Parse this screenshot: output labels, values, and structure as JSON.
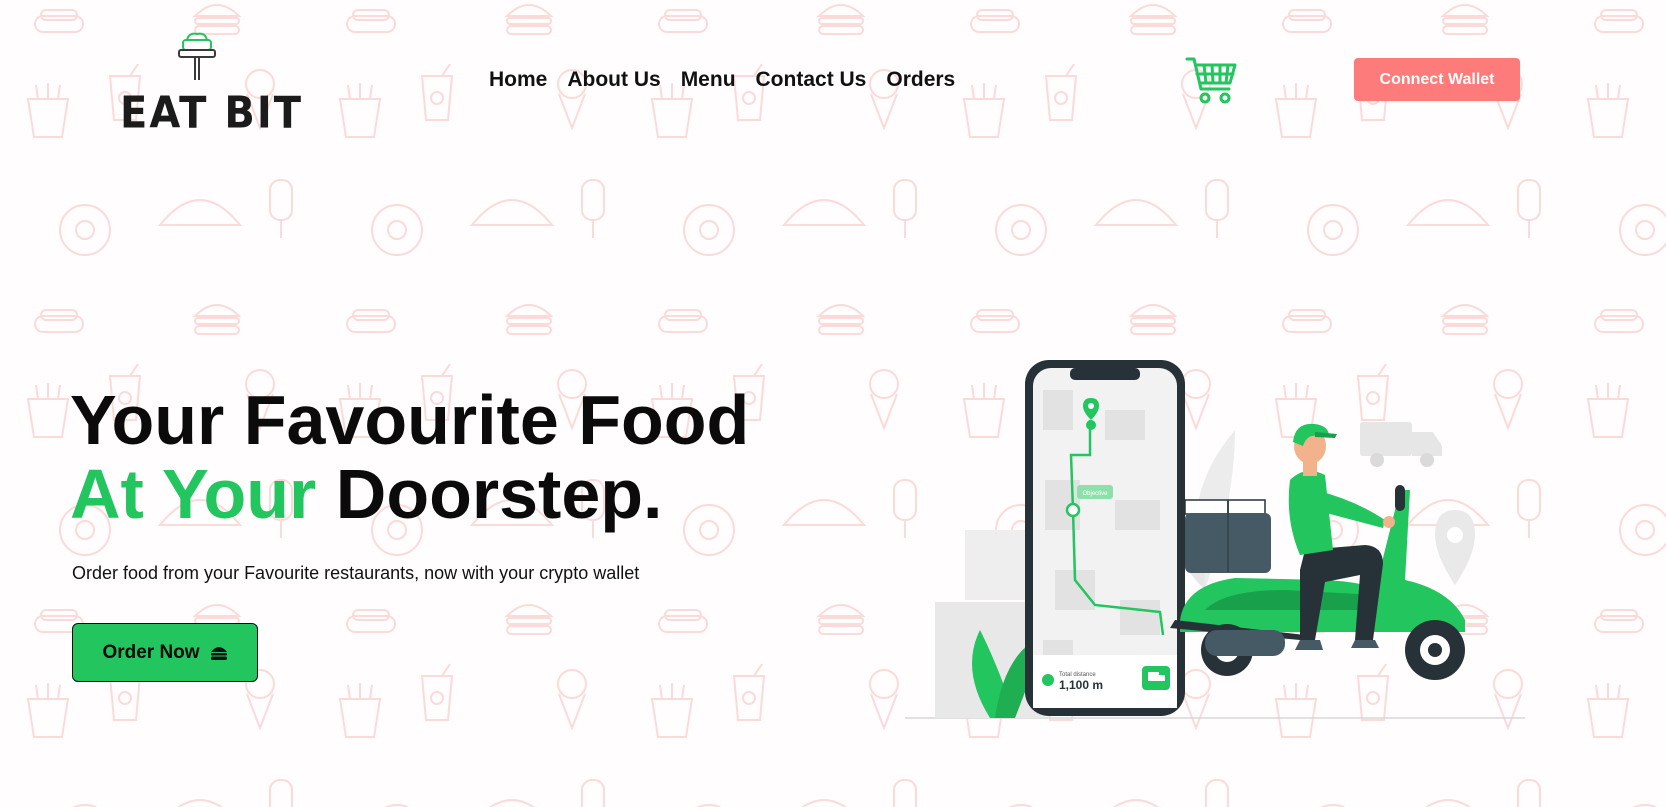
{
  "brand": {
    "name": "EAT BIT",
    "accent_color": "#22c55e",
    "cta_color": "#fe7b7b"
  },
  "nav": {
    "items": [
      {
        "label": "Home"
      },
      {
        "label": "About Us"
      },
      {
        "label": "Menu"
      },
      {
        "label": "Contact Us"
      },
      {
        "label": "Orders"
      }
    ]
  },
  "header": {
    "cart_icon": "shopping-cart-icon",
    "connect_wallet_label": "Connect Wallet"
  },
  "hero": {
    "title_line1": "Your Favourite Food",
    "title_line2_accent": "At Your",
    "title_line2_rest": " Doorstep.",
    "subtitle": "Order food from your Favourite restaurants, now with your crypto wallet",
    "cta_label": "Order Now",
    "cta_icon": "burger-icon"
  },
  "illustration": {
    "map_label": "Objective",
    "distance_label": "Total distance",
    "distance_value": "1,100 m"
  }
}
